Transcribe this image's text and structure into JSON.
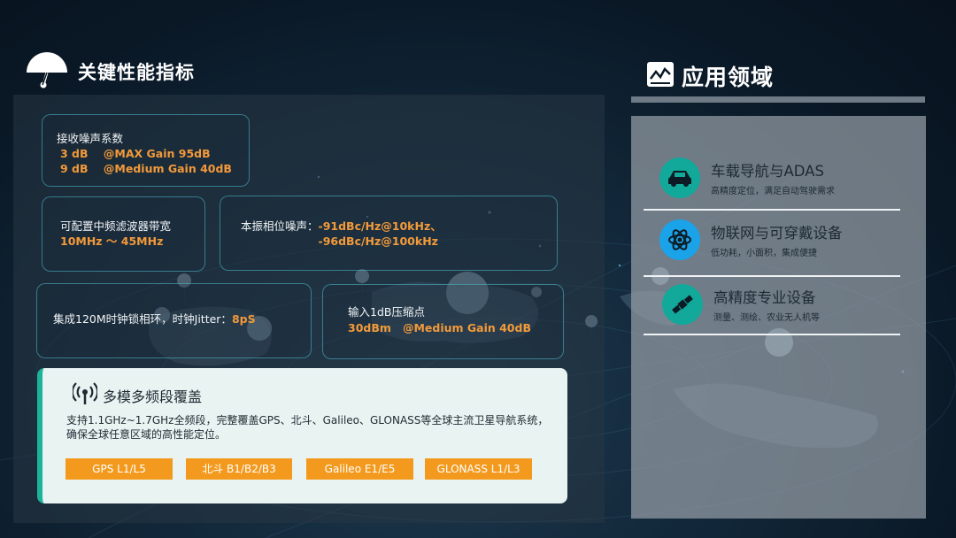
{
  "left_section": {
    "title": "关键性能指标",
    "noise_figure": {
      "label": "接收噪声系数",
      "line1": "3 dB    @MAX Gain 95dB",
      "line2": "9 dB    @Medium Gain 40dB"
    },
    "if_filter": {
      "label": "可配置中频滤波器带宽",
      "value": "10MHz ～ 45MHz"
    },
    "phase_noise": {
      "label": "本振相位噪声：",
      "value1": "-91dBc/Hz@10kHz、",
      "value2": "-96dBc/Hz@100kHz"
    },
    "jitter": {
      "label": "集成120M时钟锁相环，时钟Jitter：",
      "value": "8pS"
    },
    "compression": {
      "label": "输入1dB压缩点",
      "value": "30dBm   @Medium Gain 40dB"
    },
    "multimode": {
      "title": "多模多频段覆盖",
      "description": "支持1.1GHz~1.7GHz全频段，完整覆盖GPS、北斗、Galileo、GLONASS等全球主流卫星导航系统，确保全球任意区域的高性能定位。",
      "tags": [
        "GPS L1/L5",
        "北斗 B1/B2/B3",
        "Galileo E1/E5",
        "GLONASS L1/L3"
      ]
    }
  },
  "right_section": {
    "title": "应用领域",
    "items": [
      {
        "title": "车载导航与ADAS",
        "subtitle": "高精度定位，满足自动驾驶需求",
        "icon": "car-icon"
      },
      {
        "title": "物联网与可穿戴设备",
        "subtitle": "低功耗，小面积，集成便捷",
        "icon": "atom-icon"
      },
      {
        "title": "高精度专业设备",
        "subtitle": "测量、测绘、农业无人机等",
        "icon": "satellite-icon"
      }
    ]
  },
  "colors": {
    "accent_orange": "#f39a3a",
    "accent_teal": "#1db39a",
    "icon_teal": "#12a89a",
    "icon_blue": "#1aa3e8",
    "background": "#0a1826"
  }
}
